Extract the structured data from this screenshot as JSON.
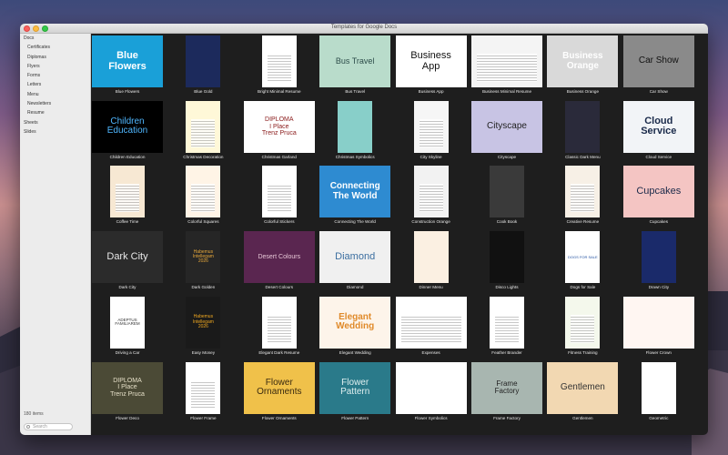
{
  "window": {
    "title": "Templates for Google Docs"
  },
  "sidebar": {
    "items": [
      {
        "label": "Docs",
        "level": "top"
      },
      {
        "label": "Certificates",
        "level": "sub"
      },
      {
        "label": "Diplomas",
        "level": "sub"
      },
      {
        "label": "Flyers",
        "level": "sub"
      },
      {
        "label": "Forms",
        "level": "sub"
      },
      {
        "label": "Letters",
        "level": "sub"
      },
      {
        "label": "Menu",
        "level": "sub"
      },
      {
        "label": "Newsletters",
        "level": "sub"
      },
      {
        "label": "Resume",
        "level": "sub"
      },
      {
        "label": "Sheets",
        "level": "top"
      },
      {
        "label": "Slides",
        "level": "top"
      }
    ],
    "count": "180 items",
    "search_placeholder": "Search"
  },
  "templates": [
    {
      "name": "Blue Flowers",
      "thumb": "Blue\nFlowers",
      "bg": "#1aa0d8",
      "fg": "#ffffff",
      "fs": 11,
      "shape": "wide",
      "weight": "bold"
    },
    {
      "name": "Blue Gold",
      "thumb": "",
      "bg": "#1c2a5c",
      "fg": "#f0c040",
      "fs": 6,
      "shape": "portrait"
    },
    {
      "name": "Bright Minimal Resume",
      "thumb": "",
      "bg": "#ffffff",
      "fg": "#555555",
      "fs": 5,
      "shape": "portrait",
      "lines": true
    },
    {
      "name": "Bus Travel",
      "thumb": "Bus Travel",
      "bg": "#b9dccb",
      "fg": "#2d4d4a",
      "fs": 9,
      "shape": "wide"
    },
    {
      "name": "Business App",
      "thumb": "Business\nApp",
      "bg": "#ffffff",
      "fg": "#111111",
      "fs": 11,
      "shape": "wide"
    },
    {
      "name": "Business Minimal Resume",
      "thumb": "",
      "bg": "#f4f4f4",
      "fg": "#555555",
      "fs": 5,
      "shape": "wide",
      "lines": true
    },
    {
      "name": "Business Orange",
      "thumb": "Business\nOrange",
      "bg": "#d9d9d9",
      "fg": "#ffffff",
      "fs": 10,
      "shape": "wide",
      "weight": "bold"
    },
    {
      "name": "Car Show",
      "thumb": "Car Show",
      "bg": "#8a8a8a",
      "fg": "#111111",
      "fs": 10,
      "shape": "wide"
    },
    {
      "name": "Children Education",
      "thumb": "Children\nEducation",
      "bg": "#000000",
      "fg": "#4fb7ff",
      "fs": 10,
      "shape": "wide"
    },
    {
      "name": "Christmas Decoration",
      "thumb": "",
      "bg": "#fff8d8",
      "fg": "#a02020",
      "fs": 5,
      "shape": "portrait",
      "lines": true
    },
    {
      "name": "Christmas Garland",
      "thumb": "DIPLOMA\nI Place\nTrenz Pruca",
      "bg": "#ffffff",
      "fg": "#8a1a1a",
      "fs": 7,
      "shape": "wide"
    },
    {
      "name": "Christmas Symbolics",
      "thumb": "",
      "bg": "#88cfc9",
      "fg": "#8a1a1a",
      "fs": 5,
      "shape": "portrait"
    },
    {
      "name": "City Skyline",
      "thumb": "",
      "bg": "#f6f6f6",
      "fg": "#555555",
      "fs": 5,
      "shape": "portrait",
      "lines": true
    },
    {
      "name": "Cityscape",
      "thumb": "Cityscape",
      "bg": "#c8c4e4",
      "fg": "#222222",
      "fs": 10,
      "shape": "wide"
    },
    {
      "name": "Classic Dark Menu",
      "thumb": "",
      "bg": "#2a2a3a",
      "fg": "#cccccc",
      "fs": 5,
      "shape": "portrait"
    },
    {
      "name": "Cloud Service",
      "thumb": "Cloud\nService",
      "bg": "#f2f4f7",
      "fg": "#1a2a4a",
      "fs": 11,
      "shape": "wide",
      "weight": "bold"
    },
    {
      "name": "Coffee Time",
      "thumb": "",
      "bg": "#f7e8d3",
      "fg": "#5a3a20",
      "fs": 5,
      "shape": "portrait",
      "lines": true
    },
    {
      "name": "Colorful Squares",
      "thumb": "",
      "bg": "#fff4e6",
      "fg": "#e8643a",
      "fs": 5,
      "shape": "portrait",
      "lines": true
    },
    {
      "name": "Colorful Stickers",
      "thumb": "",
      "bg": "#ffffff",
      "fg": "#d02020",
      "fs": 5,
      "shape": "portrait",
      "lines": true
    },
    {
      "name": "Connecting The World",
      "thumb": "Connecting\nThe World",
      "bg": "#2e8bd1",
      "fg": "#ffffff",
      "fs": 10,
      "shape": "wide",
      "weight": "bold"
    },
    {
      "name": "Construction Orange",
      "thumb": "",
      "bg": "#f2f2f2",
      "fg": "#e07020",
      "fs": 5,
      "shape": "portrait",
      "lines": true
    },
    {
      "name": "Cook Book",
      "thumb": "",
      "bg": "#3a3a3a",
      "fg": "#dddddd",
      "fs": 5,
      "shape": "portrait"
    },
    {
      "name": "Creative Resume",
      "thumb": "",
      "bg": "#f7f0e6",
      "fg": "#a06030",
      "fs": 5,
      "shape": "portrait",
      "lines": true
    },
    {
      "name": "Cupcakes",
      "thumb": "Cupcakes",
      "bg": "#f4c5c3",
      "fg": "#1a2a4a",
      "fs": 11,
      "shape": "wide"
    },
    {
      "name": "Dark City",
      "thumb": "Dark City",
      "bg": "#2b2b2b",
      "fg": "#e8e8e8",
      "fs": 11,
      "shape": "wide"
    },
    {
      "name": "Dark Golden",
      "thumb": "Habemus\nIntellegam\n2026",
      "bg": "#262626",
      "fg": "#e8a93a",
      "fs": 5,
      "shape": "portrait"
    },
    {
      "name": "Desert Colours",
      "thumb": "Desert Colours",
      "bg": "#5a2650",
      "fg": "#e6c6d6",
      "fs": 7,
      "shape": "wide"
    },
    {
      "name": "Diamond",
      "thumb": "Diamond",
      "bg": "#f0f0f0",
      "fg": "#3b6ea0",
      "fs": 11,
      "shape": "wide"
    },
    {
      "name": "Dinner Menu",
      "thumb": "",
      "bg": "#fbf0e2",
      "fg": "#555555",
      "fs": 5,
      "shape": "portrait"
    },
    {
      "name": "Disco Lights",
      "thumb": "",
      "bg": "#111111",
      "fg": "#ff30a0",
      "fs": 5,
      "shape": "portrait"
    },
    {
      "name": "Dogs for Sale",
      "thumb": "DOGS FOR SALE",
      "bg": "#ffffff",
      "fg": "#2050a0",
      "fs": 4,
      "shape": "portrait"
    },
    {
      "name": "Drawn City",
      "thumb": "",
      "bg": "#1a2a6a",
      "fg": "#ffffff",
      "fs": 5,
      "shape": "portrait"
    },
    {
      "name": "Driving a Car",
      "thumb": "ADEPTUS\nFAMILIAREM",
      "bg": "#ffffff",
      "fg": "#333333",
      "fs": 4.5,
      "shape": "portrait"
    },
    {
      "name": "Easy Money",
      "thumb": "Habemus\nIntellegam\n2026",
      "bg": "#1a1a1a",
      "fg": "#f0a820",
      "fs": 5,
      "shape": "portrait"
    },
    {
      "name": "Elegant Dark Resume",
      "thumb": "",
      "bg": "#ffffff",
      "fg": "#333333",
      "fs": 5,
      "shape": "portrait",
      "lines": true
    },
    {
      "name": "Elegant Wedding",
      "thumb": "Elegant\nWedding",
      "bg": "#fdf4ea",
      "fg": "#e08a2a",
      "fs": 10,
      "shape": "wide",
      "weight": "bold"
    },
    {
      "name": "Expenses",
      "thumb": "",
      "bg": "#ffffff",
      "fg": "#3070b0",
      "fs": 5,
      "shape": "wide",
      "lines": true
    },
    {
      "name": "Feather Brander",
      "thumb": "",
      "bg": "#ffffff",
      "fg": "#333333",
      "fs": 5,
      "shape": "portrait",
      "lines": true
    },
    {
      "name": "Fitness Training",
      "thumb": "",
      "bg": "#f4f8ec",
      "fg": "#7aa030",
      "fs": 5,
      "shape": "portrait",
      "lines": true
    },
    {
      "name": "Flower Crown",
      "thumb": "",
      "bg": "#fff6f2",
      "fg": "#c07080",
      "fs": 5,
      "shape": "wide"
    },
    {
      "name": "Flower Deco",
      "thumb": "DIPLOMA\nI Place\nTrenz Pruca",
      "bg": "#4b4a36",
      "fg": "#e6e0c8",
      "fs": 7,
      "shape": "wide"
    },
    {
      "name": "Flower Frame",
      "thumb": "",
      "bg": "#ffffff",
      "fg": "#7aa0d0",
      "fs": 5,
      "shape": "portrait",
      "lines": true
    },
    {
      "name": "Flower Ornaments",
      "thumb": "Flower\nOrnaments",
      "bg": "#f0c14a",
      "fg": "#3a2a10",
      "fs": 10,
      "shape": "wide"
    },
    {
      "name": "Flower Pattern",
      "thumb": "Flower\nPattern",
      "bg": "#2a7a8a",
      "fg": "#e0f0f0",
      "fs": 10,
      "shape": "wide"
    },
    {
      "name": "Flower Symbolics",
      "thumb": "",
      "bg": "#ffffff",
      "fg": "#a06070",
      "fs": 5,
      "shape": "wide"
    },
    {
      "name": "Frame Factory",
      "thumb": "Frame\nFactory",
      "bg": "#a8b6b0",
      "fg": "#222222",
      "fs": 8,
      "shape": "wide"
    },
    {
      "name": "Gentlemen",
      "thumb": "Gentlemen",
      "bg": "#f2d8b2",
      "fg": "#333333",
      "fs": 10,
      "shape": "wide"
    },
    {
      "name": "Geometric",
      "thumb": "",
      "bg": "#ffffff",
      "fg": "#8a2a7a",
      "fs": 5,
      "shape": "portrait"
    }
  ]
}
